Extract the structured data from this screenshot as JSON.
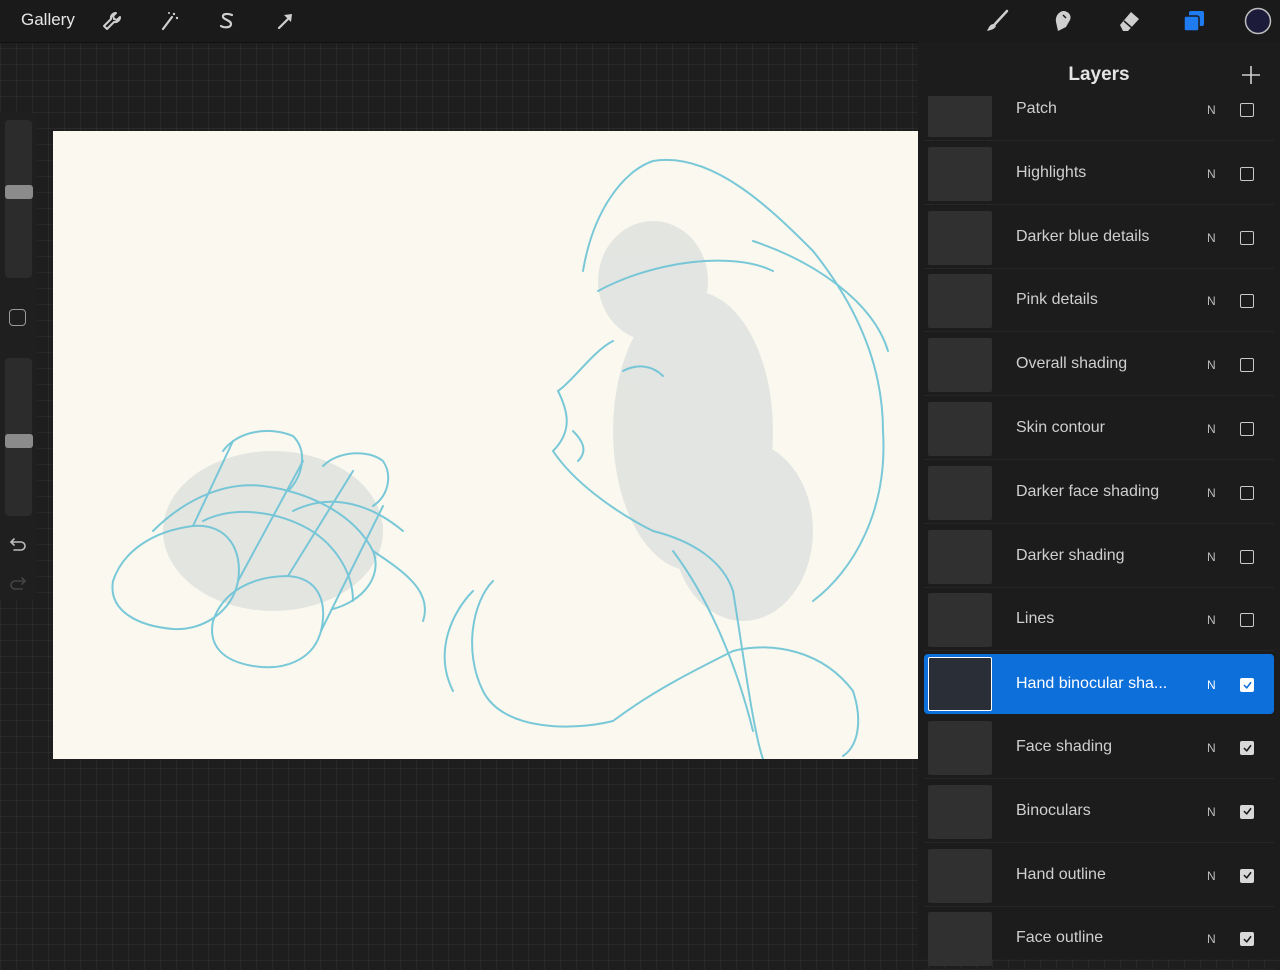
{
  "topbar": {
    "gallery_label": "Gallery",
    "left_tools": [
      "wrench-icon",
      "magic-wand-icon",
      "selection-s-icon",
      "transform-arrow-icon"
    ],
    "right_tools": [
      "brush-icon",
      "smudge-icon",
      "eraser-icon",
      "layers-icon",
      "color-swatch"
    ],
    "accent_color": "#1e7bf0",
    "active_color": "#1c1c3a"
  },
  "sidebar": {
    "size_level": 0.5,
    "opacity_level": 0.5,
    "tools": [
      "modify-square",
      "undo-icon",
      "redo-icon"
    ]
  },
  "layers": {
    "title": "Layers",
    "add_icon": "plus-icon",
    "items": [
      {
        "name": "Patch",
        "blend": "N",
        "visible": false,
        "active": false
      },
      {
        "name": "Highlights",
        "blend": "N",
        "visible": false,
        "active": false
      },
      {
        "name": "Darker blue details",
        "blend": "N",
        "visible": false,
        "active": false
      },
      {
        "name": "Pink details",
        "blend": "N",
        "visible": false,
        "active": false
      },
      {
        "name": "Overall shading",
        "blend": "N",
        "visible": false,
        "active": false
      },
      {
        "name": "Skin contour",
        "blend": "N",
        "visible": false,
        "active": false
      },
      {
        "name": "Darker face shading",
        "blend": "N",
        "visible": false,
        "active": false
      },
      {
        "name": "Darker shading",
        "blend": "N",
        "visible": false,
        "active": false
      },
      {
        "name": "Lines",
        "blend": "N",
        "visible": false,
        "active": false
      },
      {
        "name": "Hand binocular sha...",
        "blend": "N",
        "visible": true,
        "active": true
      },
      {
        "name": "Face shading",
        "blend": "N",
        "visible": true,
        "active": false
      },
      {
        "name": "Binoculars",
        "blend": "N",
        "visible": true,
        "active": false
      },
      {
        "name": "Hand outline",
        "blend": "N",
        "visible": true,
        "active": false
      },
      {
        "name": "Face outline",
        "blend": "N",
        "visible": true,
        "active": false
      }
    ]
  },
  "canvas": {
    "background_color": "#fbf9ef",
    "line_color": "#6cc3d6"
  }
}
